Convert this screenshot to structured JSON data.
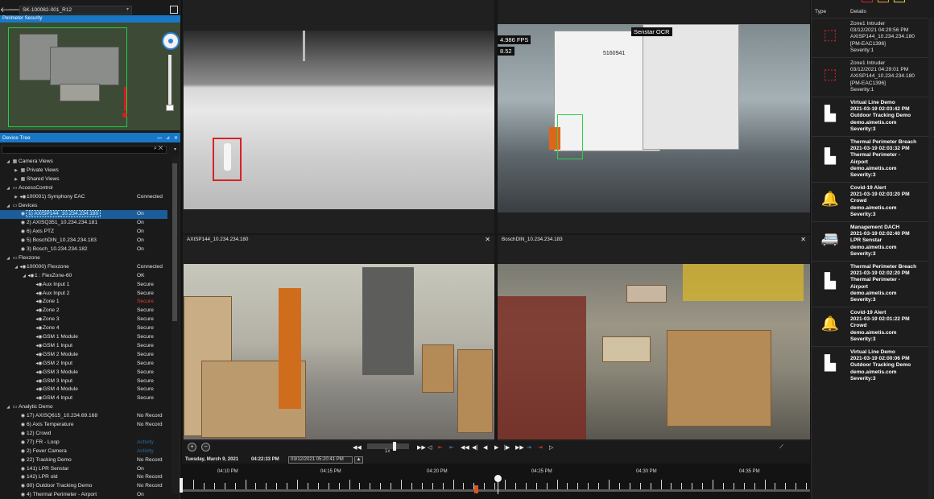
{
  "site": {
    "name": "SK-100082-001_R12",
    "map_title": "Perimeter Security"
  },
  "device_tree": {
    "title": "Device Tree",
    "rows": [
      {
        "level": 0,
        "exp": "◢",
        "icon": "▦",
        "label": "Camera Views",
        "status": ""
      },
      {
        "level": 1,
        "exp": "▶",
        "icon": "▦",
        "label": "Private Views",
        "status": ""
      },
      {
        "level": 1,
        "exp": "▶",
        "icon": "▦",
        "label": "Shared Views",
        "status": ""
      },
      {
        "level": 0,
        "exp": "◢",
        "icon": "▭",
        "label": "AccessControl",
        "status": ""
      },
      {
        "level": 1,
        "exp": "▶",
        "icon": "◂◉",
        "label": "100001) Symphony EAC",
        "status": "Connected"
      },
      {
        "level": 0,
        "exp": "◢",
        "icon": "▭",
        "label": "Devices",
        "status": ""
      },
      {
        "level": 1,
        "exp": "",
        "icon": "◉",
        "label": "1) AXISP144_10.234.234.180",
        "status": "On",
        "selected": true
      },
      {
        "level": 1,
        "exp": "",
        "icon": "◉",
        "label": "2) AXISQ351_10.234.234.181",
        "status": "On"
      },
      {
        "level": 1,
        "exp": "",
        "icon": "◉",
        "label": "6) Axis PTZ",
        "status": "On"
      },
      {
        "level": 1,
        "exp": "",
        "icon": "◉",
        "label": "5) BoschDIN_10.234.234.183",
        "status": "On"
      },
      {
        "level": 1,
        "exp": "",
        "icon": "◉",
        "label": "3) Bosch_10.234.234.182",
        "status": "On"
      },
      {
        "level": 0,
        "exp": "◢",
        "icon": "▭",
        "label": "Flexzone",
        "status": ""
      },
      {
        "level": 1,
        "exp": "◢",
        "icon": "◂◉",
        "label": "100000) Flexzone",
        "status": "Connected"
      },
      {
        "level": 2,
        "exp": "◢",
        "icon": "◂◉",
        "label": "1 : FlexZone-60",
        "status": "OK"
      },
      {
        "level": 3,
        "exp": "",
        "icon": "◂◉",
        "label": "Aux Input 1",
        "status": "Secure"
      },
      {
        "level": 3,
        "exp": "",
        "icon": "◂◉",
        "label": "Aux Input 2",
        "status": "Secure"
      },
      {
        "level": 3,
        "exp": "",
        "icon": "◂◉",
        "label": "Zone 1",
        "status": "Secure",
        "red": true
      },
      {
        "level": 3,
        "exp": "",
        "icon": "◂◉",
        "label": "Zone 2",
        "status": "Secure"
      },
      {
        "level": 3,
        "exp": "",
        "icon": "◂◉",
        "label": "Zone 3",
        "status": "Secure"
      },
      {
        "level": 3,
        "exp": "",
        "icon": "◂◉",
        "label": "Zone 4",
        "status": "Secure"
      },
      {
        "level": 3,
        "exp": "",
        "icon": "◂◉",
        "label": "GSM 1 Module",
        "status": "Secure"
      },
      {
        "level": 3,
        "exp": "",
        "icon": "◂◉",
        "label": "GSM 1 Input",
        "status": "Secure"
      },
      {
        "level": 3,
        "exp": "",
        "icon": "◂◉",
        "label": "GSM 2 Module",
        "status": "Secure"
      },
      {
        "level": 3,
        "exp": "",
        "icon": "◂◉",
        "label": "GSM 2 Input",
        "status": "Secure"
      },
      {
        "level": 3,
        "exp": "",
        "icon": "◂◉",
        "label": "GSM 3 Module",
        "status": "Secure"
      },
      {
        "level": 3,
        "exp": "",
        "icon": "◂◉",
        "label": "GSM 3 Input",
        "status": "Secure"
      },
      {
        "level": 3,
        "exp": "",
        "icon": "◂◉",
        "label": "GSM 4 Module",
        "status": "Secure"
      },
      {
        "level": 3,
        "exp": "",
        "icon": "◂◉",
        "label": "GSM 4 Input",
        "status": "Secure"
      },
      {
        "level": 0,
        "exp": "◢",
        "icon": "▭",
        "label": "Analytic Demo",
        "status": ""
      },
      {
        "level": 1,
        "exp": "",
        "icon": "◉",
        "label": "17) AXISQ615_10.234.69.168",
        "status": "No Record"
      },
      {
        "level": 1,
        "exp": "",
        "icon": "◉",
        "label": "6) Axis Temperature",
        "status": "No Record"
      },
      {
        "level": 1,
        "exp": "",
        "icon": "◉",
        "label": "12) Crowd",
        "status": ""
      },
      {
        "level": 1,
        "exp": "",
        "icon": "◉",
        "label": "77) FR - Loop",
        "status": "Activity",
        "blue": true
      },
      {
        "level": 1,
        "exp": "",
        "icon": "◉",
        "label": "2) Fever Camera",
        "status": "Activity",
        "blue": true
      },
      {
        "level": 1,
        "exp": "",
        "icon": "◉",
        "label": "22)  Tracking Demo",
        "status": "No Record"
      },
      {
        "level": 1,
        "exp": "",
        "icon": "◉",
        "label": "141) LPR Senstar",
        "status": "On"
      },
      {
        "level": 1,
        "exp": "",
        "icon": "◉",
        "label": "142) LPR old",
        "status": "No Record"
      },
      {
        "level": 1,
        "exp": "",
        "icon": "◉",
        "label": "80) Outdoor Tracking Demo",
        "status": "No Record"
      },
      {
        "level": 1,
        "exp": "",
        "icon": "◉",
        "label": "4) Thermal Perimeter - Airport",
        "status": "On"
      }
    ]
  },
  "cameras": [
    {
      "title": "",
      "closeable": false
    },
    {
      "title": "",
      "closeable": false,
      "fps": "4.986 FPS",
      "sub": "8.52",
      "ocr_label": "Senstar OCR",
      "trailer_no": "5160941"
    },
    {
      "title": "AXISP144_10.234.234.180",
      "closeable": true
    },
    {
      "title": "BoschDIN_10.234.234.183",
      "closeable": true
    }
  ],
  "playback": {
    "speed": "1x",
    "date_label": "Tuesday, March 9, 2021",
    "time_label": "04:22:33 PM",
    "datetime_input": "03/12/2021 05:20:41 PM",
    "timeline_labels": [
      "04:10 PM",
      "04:15 PM",
      "04:20 PM",
      "04:25 PM",
      "04:30 PM",
      "04:35 PM"
    ],
    "playhead_fraction": 0.505
  },
  "alarms": {
    "col_type": "Type",
    "col_details": "Details",
    "items": [
      {
        "icon": "motion-sensor-icon",
        "lines": [
          "Zone1 Intruder",
          "03/12/2021 04:29:56 PM",
          "AXISP144_10.234.234.180",
          "[PM-EAC1396]",
          "Severity:1"
        ],
        "bold": false
      },
      {
        "icon": "motion-sensor-icon",
        "lines": [
          "Zone1 Intruder",
          "03/12/2021 04:29:01 PM",
          "AXISP144_10.234.234.180",
          "[PM-EAC1396]",
          "Severity:1"
        ],
        "bold": false
      },
      {
        "icon": "camera-person-icon",
        "lines": [
          "Virtual Line Demo",
          "2021-03-19 02:03:42 PM",
          "Outdoor Tracking Demo",
          "demo.aimetis.com",
          "Severity:3"
        ],
        "bold": true
      },
      {
        "icon": "camera-person-icon",
        "lines": [
          "Thermal Perimeter Breach",
          "2021-03-19 02:03:32 PM",
          "Thermal Perimeter -",
          "Airport",
          "demo.aimetis.com",
          "Severity:3"
        ],
        "bold": true
      },
      {
        "icon": "bell-icon",
        "lines": [
          "Covid-19 Alert",
          "2021-03-19 02:03:20 PM",
          "Crowd",
          "demo.aimetis.com",
          "Severity:3"
        ],
        "bold": true
      },
      {
        "icon": "car-icon",
        "lines": [
          "Management DACH",
          "2021-03-19 02:02:40 PM",
          "LPR Senstar",
          "demo.aimetis.com",
          "Severity:3"
        ],
        "bold": true
      },
      {
        "icon": "camera-person-icon",
        "lines": [
          "Thermal Perimeter Breach",
          "2021-03-19 02:02:20 PM",
          "Thermal Perimeter -",
          "Airport",
          "demo.aimetis.com",
          "Severity:3"
        ],
        "bold": true
      },
      {
        "icon": "bell-icon",
        "lines": [
          "Covid-19 Alert",
          "2021-03-19 02:01:22 PM",
          "Crowd",
          "demo.aimetis.com",
          "Severity:3"
        ],
        "bold": true
      },
      {
        "icon": "camera-person-icon",
        "lines": [
          "Virtual Line Demo",
          "2021-03-19 02:00:06 PM",
          "Outdoor Tracking Demo",
          "demo.aimetis.com",
          "Severity:3"
        ],
        "bold": true
      }
    ]
  }
}
